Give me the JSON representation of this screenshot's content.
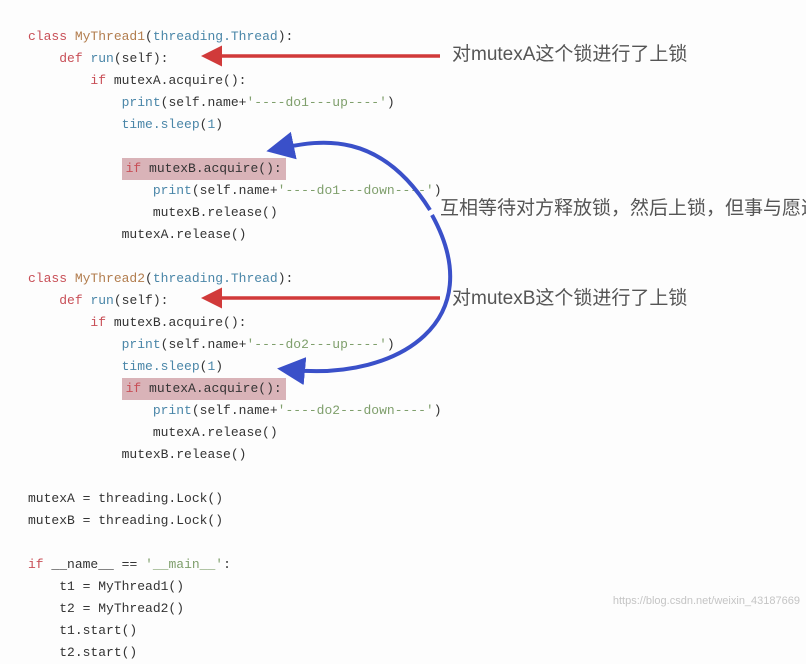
{
  "code": {
    "t1_class": "MyThread1",
    "thread_base": "threading.Thread",
    "def_run": "run",
    "self": "self",
    "if_kw": "if",
    "class_kw": "class",
    "def_kw": "def",
    "mutexA_acq": "mutexA.acquire():",
    "mutexB_acq": "mutexB.acquire():",
    "print_fn": "print",
    "do1_up": "'----do1---up----'",
    "do1_down": "'----do1---down----'",
    "do2_up": "'----do2---up----'",
    "do2_down": "'----do2---down----'",
    "time_sleep": "time.sleep",
    "one": "1",
    "mutexB_rel": "mutexB.release()",
    "mutexA_rel": "mutexA.release()",
    "t2_class": "MyThread2",
    "lock_assign_A": "mutexA = threading.Lock()",
    "lock_assign_B": "mutexB = threading.Lock()",
    "name_main": "__name__",
    "main_str": "'__main__'",
    "eqeq": " == ",
    "t1_assign": "t1 = MyThread1()",
    "t2_assign": "t2 = MyThread2()",
    "t1_start": "t1.start()",
    "t2_start": "t2.start()"
  },
  "annotations": {
    "a_lock": "对mutexA这个锁进行了上锁",
    "b_lock": "对mutexB这个锁进行了上锁",
    "deadlock": "互相等待对方释放锁，然后上锁，但事与愿违"
  },
  "watermark": "https://blog.csdn.net/weixin_43187669"
}
